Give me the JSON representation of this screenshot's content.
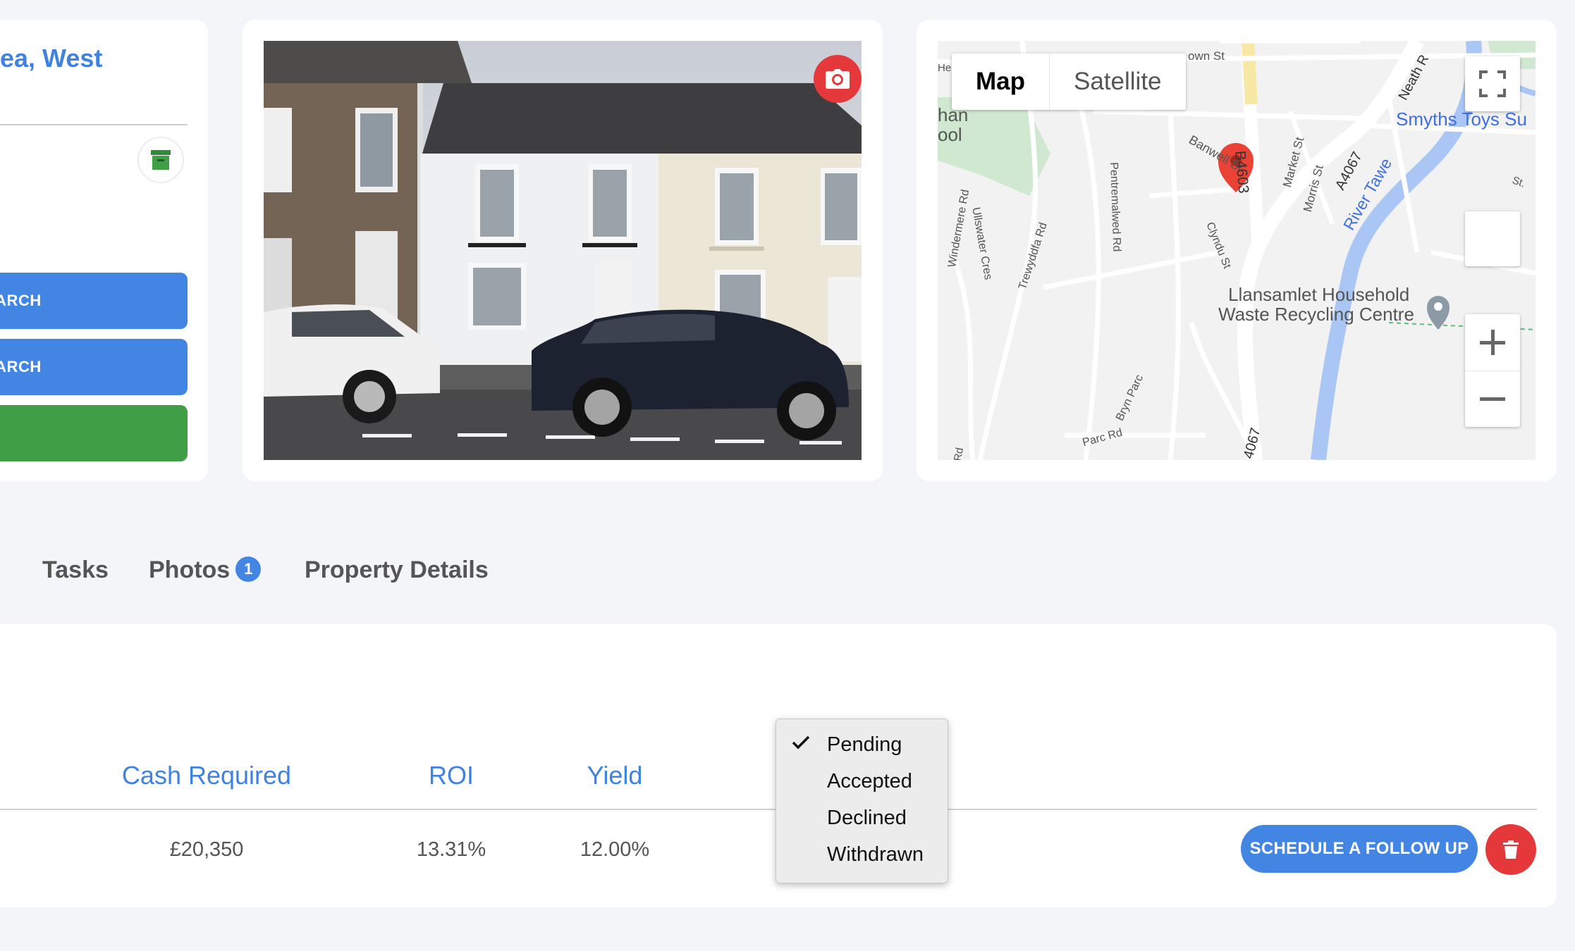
{
  "left_panel": {
    "address_fragment": "ea, West",
    "buttons": [
      {
        "label": "EARCH",
        "color": "#4285e3"
      },
      {
        "label": "EARCH",
        "color": "#4285e3"
      },
      {
        "label": "",
        "color": "#3f9e46"
      }
    ]
  },
  "map": {
    "type_options": [
      "Map",
      "Satellite"
    ],
    "active_type": "Map",
    "labels": {
      "smyths": "Smyths Toys Su",
      "recycling_line1": "Llansamlet Household",
      "recycling_line2": "Waste Recycling Centre",
      "river": "River Tawe",
      "banwell": "Banwell St",
      "b4603": "B4603",
      "market": "Market St",
      "morris": "Morris St",
      "a4067": "A4067",
      "a4067_bottom": "4067",
      "neath": "Neath R",
      "town": "own St",
      "windermere": "Windermere Rd",
      "ullswater": "Ullswater Cres",
      "trewyddfa": "Trewyddfa Rd",
      "pentremalwed": "Pentremalwed Rd",
      "clyndu": "Clyndu St",
      "bryn_parc": "Bryn Parc",
      "parc_rd": "Parc Rd",
      "han": "han",
      "ool": "ool",
      "he": "He",
      "st": "St.",
      "rd_bottom": "Rd"
    }
  },
  "tabs": [
    {
      "label": "Tasks"
    },
    {
      "label": "Photos",
      "badge": "1"
    },
    {
      "label": "Property Details"
    }
  ],
  "table": {
    "headers": [
      "Cash Required",
      "ROI",
      "Yield"
    ],
    "row": {
      "cash_required": "£20,350",
      "roi": "13.31%",
      "yield": "12.00%"
    },
    "follow_up_label": "SCHEDULE A FOLLOW UP"
  },
  "status_dropdown": {
    "selected": "Pending",
    "options": [
      "Pending",
      "Accepted",
      "Declined",
      "Withdrawn"
    ]
  },
  "colors": {
    "accent": "#4285e3",
    "success": "#3f9e46",
    "danger": "#e5383b",
    "link": "#3f82e0"
  }
}
